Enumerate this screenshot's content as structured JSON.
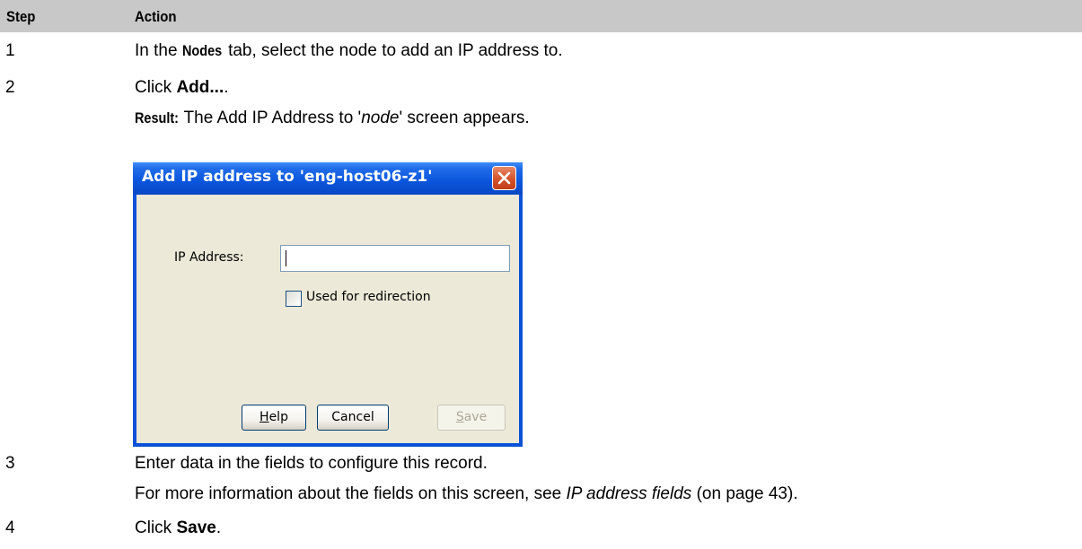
{
  "table": {
    "col_step": "Step",
    "col_action": "Action"
  },
  "steps": [
    {
      "num": "1",
      "pre": "In the ",
      "bold": "Nodes",
      "post": " tab, select the node to add an IP address to."
    },
    {
      "num": "2",
      "pre": "Click ",
      "bold": "Add...",
      "post": ".",
      "result_label": "Result:",
      "result_pre": " The Add IP Address to '",
      "result_italic": "node",
      "result_post": "' screen appears."
    },
    {
      "num": "3",
      "line1": "Enter data in the fields to configure this record.",
      "line2_pre": "For more information about the fields on this screen, see ",
      "line2_italic": "IP address fields",
      "line2_post": " (on page 43)."
    },
    {
      "num": "4",
      "pre": "Click ",
      "bold": "Save",
      "post": "."
    }
  ],
  "dialog": {
    "title": "Add IP address to 'eng-host06-z1'",
    "ip_label": "IP Address:",
    "ip_value": "",
    "checkbox_label": "Used for redirection",
    "checkbox_checked": false,
    "help_mnemonic": "H",
    "help_rest": "elp",
    "cancel": "Cancel",
    "save_mnemonic": "S",
    "save_rest": "ave",
    "save_enabled": false,
    "close_icon": "close-x-icon",
    "titlebar_color": "#0a55dc",
    "body_color": "#ece9d8"
  }
}
